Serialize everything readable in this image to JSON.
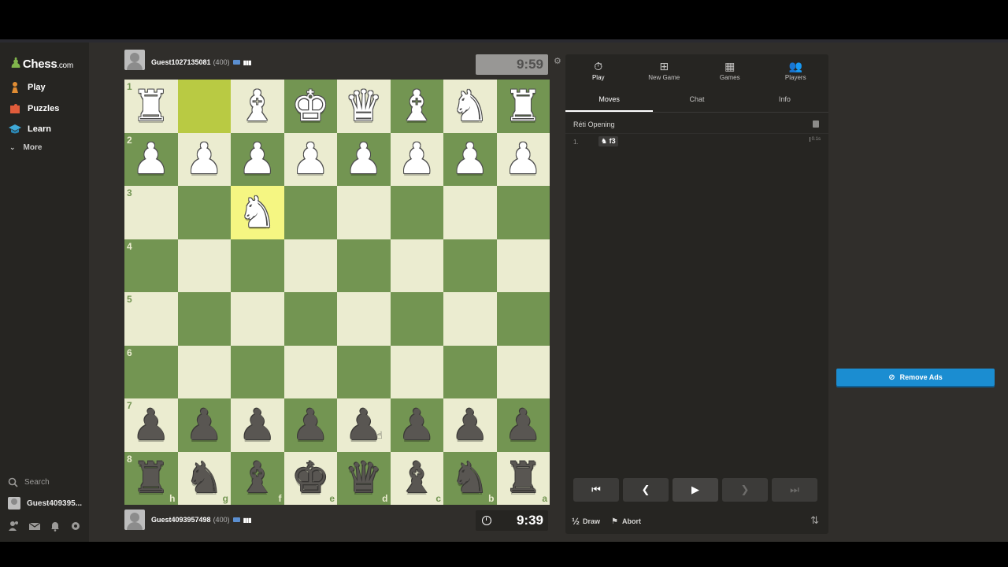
{
  "sidebar": {
    "logo_main": "Chess",
    "logo_suffix": ".com",
    "items": [
      {
        "label": "Play",
        "icon": "pawn-hand-icon",
        "color": "#e08c33"
      },
      {
        "label": "Puzzles",
        "icon": "puzzle-icon",
        "color": "#e05c3b"
      },
      {
        "label": "Learn",
        "icon": "graduation-cap-icon",
        "color": "#3fa8d6"
      }
    ],
    "more_label": "More",
    "search_label": "Search",
    "user_label": "Guest409395..."
  },
  "opponent": {
    "name": "Guest1027135081",
    "rating": "(400)",
    "clock": "9:59"
  },
  "player": {
    "name": "Guest4093957498",
    "rating": "(400)",
    "clock": "9:39"
  },
  "board": {
    "orientation": "black",
    "ranks": [
      "1",
      "2",
      "3",
      "4",
      "5",
      "6",
      "7",
      "8"
    ],
    "files": [
      "h",
      "g",
      "f",
      "e",
      "d",
      "c",
      "b",
      "a"
    ],
    "rows": [
      [
        "wR",
        "",
        "wB",
        "wK",
        "wQ",
        "wB",
        "wN",
        "wR"
      ],
      [
        "wP",
        "wP",
        "wP",
        "wP",
        "wP",
        "wP",
        "wP",
        "wP"
      ],
      [
        "",
        "",
        "wN",
        "",
        "",
        "",
        "",
        ""
      ],
      [
        "",
        "",
        "",
        "",
        "",
        "",
        "",
        ""
      ],
      [
        "",
        "",
        "",
        "",
        "",
        "",
        "",
        ""
      ],
      [
        "",
        "",
        "",
        "",
        "",
        "",
        "",
        ""
      ],
      [
        "bP",
        "bP",
        "bP",
        "bP",
        "bP",
        "bP",
        "bP",
        "bP"
      ],
      [
        "bR",
        "bN",
        "bB",
        "bK",
        "bQ",
        "bB",
        "bN",
        "bR"
      ]
    ],
    "highlight_from": [
      0,
      1
    ],
    "highlight_to": [
      2,
      2
    ],
    "colors": {
      "light": "#ebecd0",
      "dark": "#739552",
      "highlight": "#f5f682"
    }
  },
  "panel": {
    "tabs": [
      {
        "label": "Play",
        "icon": "stopwatch-icon"
      },
      {
        "label": "New Game",
        "icon": "plus-square-icon"
      },
      {
        "label": "Games",
        "icon": "board-icon"
      },
      {
        "label": "Players",
        "icon": "players-icon"
      }
    ],
    "subtabs": [
      "Moves",
      "Chat",
      "Info"
    ],
    "opening": "Réti Opening",
    "moves": [
      {
        "no": "1.",
        "san": "f3",
        "piece": "knight"
      }
    ],
    "move_time": "0.1s",
    "draw_label": "Draw",
    "abort_label": "Abort",
    "half_label": "½"
  },
  "remove_ads": "Remove Ads"
}
